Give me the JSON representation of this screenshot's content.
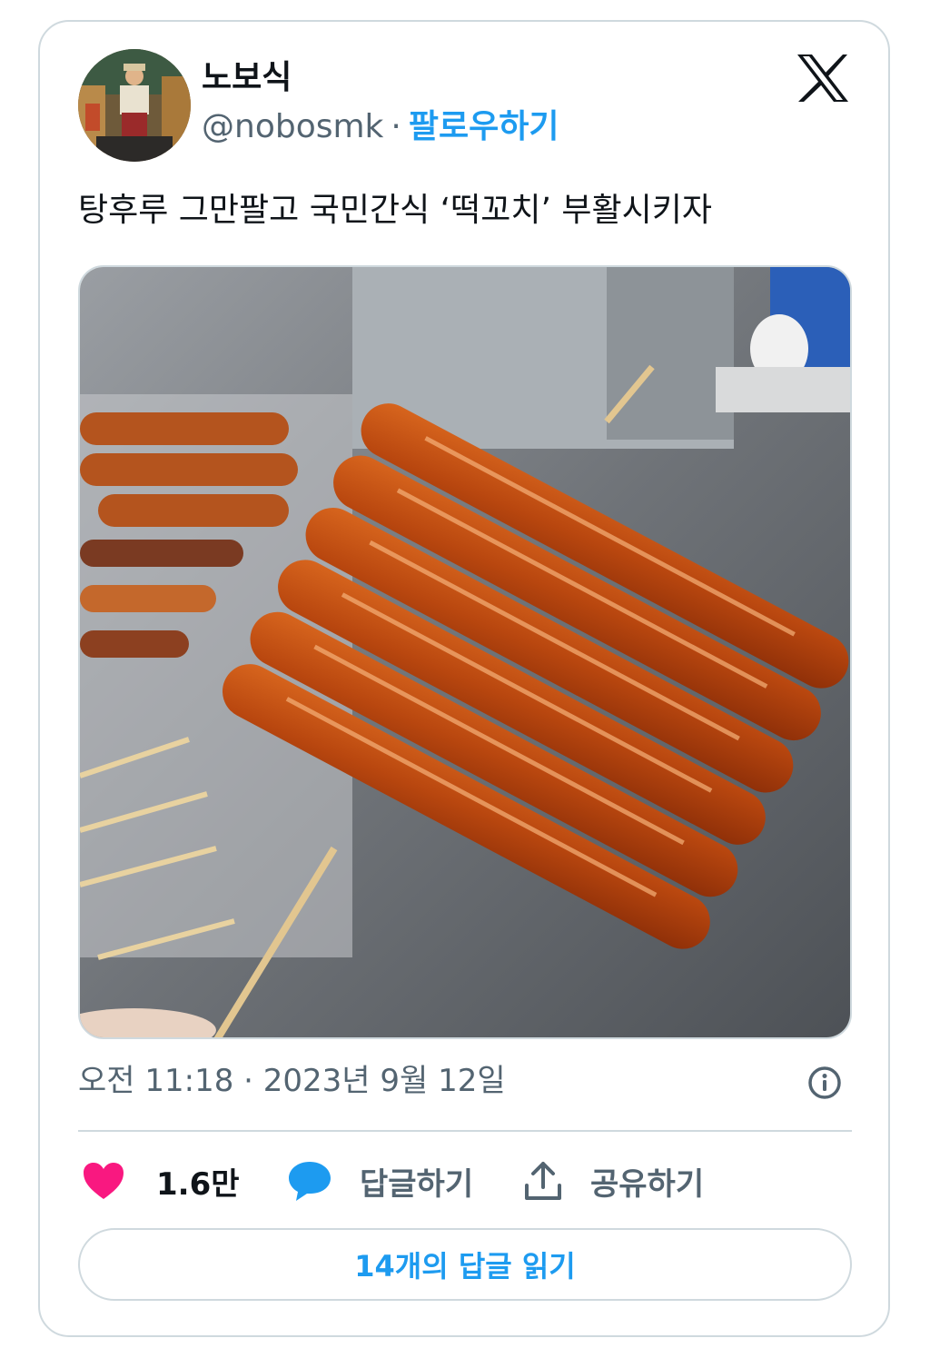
{
  "author": {
    "display_name": "노보식",
    "handle": "@nobosmk",
    "separator": "·",
    "follow_label": "팔로우하기"
  },
  "tweet": {
    "text": "탕후루 그만팔고 국민간식 ‘떡꼬치’ 부활시키자",
    "timestamp": "오전 11:18 · 2023년 9월 12일"
  },
  "actions": {
    "likes": "1.6만",
    "reply_label": "답글하기",
    "share_label": "공유하기"
  },
  "read_replies_label": "14개의 답글 읽기",
  "colors": {
    "accent": "#1d9bf0",
    "like": "#f91880",
    "secondary_text": "#536471",
    "border": "#cfd9de"
  },
  "icons": {
    "brand": "x-logo-icon",
    "info": "info-icon",
    "like": "heart-icon",
    "reply": "speech-bubble-icon",
    "share": "share-upload-icon"
  }
}
